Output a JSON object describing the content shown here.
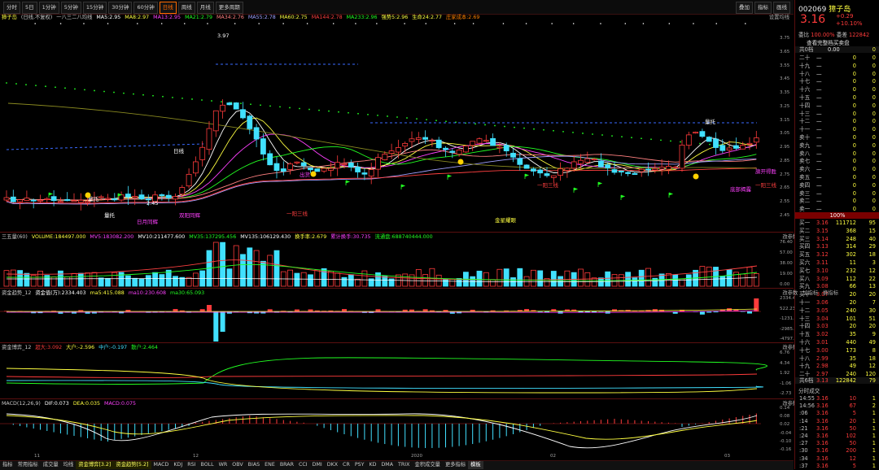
{
  "toolbar": {
    "periods": [
      "分时",
      "5日",
      "1分钟",
      "5分钟",
      "15分钟",
      "30分钟",
      "60分钟",
      "日线",
      "周线",
      "月线",
      "更多周期"
    ],
    "active_period": "日线",
    "right_buttons": [
      "叠加",
      "指标",
      "画线"
    ]
  },
  "main_header": {
    "title": "獐子岛",
    "mode": "(日线,不复权)",
    "items": [
      {
        "text": "一八三二八均线",
        "color": "#c8c8c8"
      },
      {
        "text": "MA5:2.95",
        "color": "#ffffff"
      },
      {
        "text": "MA8:2.97",
        "color": "#ffff40"
      },
      {
        "text": "MA13:2.95",
        "color": "#ff40ff"
      },
      {
        "text": "MA21:2.79",
        "color": "#22ff22"
      },
      {
        "text": "MA34:2.76",
        "color": "#ff8080"
      },
      {
        "text": "MA55:2.78",
        "color": "#a0a0ff"
      },
      {
        "text": "MA60:2.75",
        "color": "#ffff40"
      },
      {
        "text": "MA144:2.78",
        "color": "#ff4040"
      },
      {
        "text": "MA233:2.96",
        "color": "#22ff22"
      },
      {
        "text": "强势5:2.96",
        "color": "#ffff40"
      },
      {
        "text": "生命24:2.77",
        "color": "#ffff40"
      },
      {
        "text": "庄家成本:2.69",
        "color": "#ff8000"
      }
    ],
    "right_label": "设置均线"
  },
  "price_axis": [
    "3.75",
    "3.65",
    "3.55",
    "3.45",
    "3.35",
    "3.25",
    "3.15",
    "3.05",
    "2.95",
    "2.85",
    "2.75",
    "2.65",
    "2.55",
    "2.45"
  ],
  "annotations": [
    {
      "text": "3.97",
      "color": "#ffffff"
    },
    {
      "text": "量托",
      "color": "#ffffff"
    },
    {
      "text": "量托",
      "color": "#ffffff"
    },
    {
      "text": "量托",
      "color": "#ffffff"
    },
    {
      "text": "2.45",
      "color": "#ffffff"
    },
    {
      "text": "日月同辉",
      "color": "#ff40ff"
    },
    {
      "text": "双阳同辉",
      "color": "#ff40ff"
    },
    {
      "text": "日线",
      "color": "#ffffff"
    },
    {
      "text": "一阳三线",
      "color": "#ff4040"
    },
    {
      "text": "一阳三线",
      "color": "#ff4040"
    },
    {
      "text": "一阳三线",
      "color": "#ff4040"
    },
    {
      "text": "金星耀眼",
      "color": "#ffff40"
    },
    {
      "text": "旗开得胜",
      "color": "#ff40ff"
    },
    {
      "text": "底部揭露",
      "color": "#ff40ff"
    },
    {
      "text": "出货",
      "color": "#ff40ff"
    }
  ],
  "volume_panel": {
    "header": [
      {
        "text": "三五量(60)",
        "color": "#c8c8c8"
      },
      {
        "text": "VOLUME:184497.000",
        "color": "#ffff40"
      },
      {
        "text": "MV5:183082.200",
        "color": "#ff40ff"
      },
      {
        "text": "MV10:211477.600",
        "color": "#ffffff"
      },
      {
        "text": "MV35:137295.456",
        "color": "#22ff22"
      },
      {
        "text": "MV135:106129.430",
        "color": "#ffffff"
      },
      {
        "text": "换手率:2.679",
        "color": "#ffff40"
      },
      {
        "text": "累计换手:30.735",
        "color": "#ff40ff"
      },
      {
        "text": "流通盘:688740444.000",
        "color": "#22ff22"
      }
    ],
    "axis": [
      "76.40",
      "57.00",
      "38.00",
      "19.00",
      "0.00"
    ]
  },
  "money_panel": {
    "header": [
      {
        "text": "资金趋势_12",
        "color": "#c8c8c8"
      },
      {
        "text": "资金值(万):2334.403",
        "color": "#ffffff"
      },
      {
        "text": "ma5:415.088",
        "color": "#ffff40"
      },
      {
        "text": "ma10:230.608",
        "color": "#ff40ff"
      },
      {
        "text": "ma30:65.093",
        "color": "#22ff22"
      }
    ],
    "axis": [
      "2334.40",
      "522.23",
      "-1231.48",
      "-2985.21",
      "-4797.38"
    ]
  },
  "flow_panel": {
    "header": [
      {
        "text": "资金博弈_12",
        "color": "#c8c8c8"
      },
      {
        "text": "超大:3.092",
        "color": "#ff3b3b"
      },
      {
        "text": "大户:-2.596",
        "color": "#ffff40"
      },
      {
        "text": "中户:-0.197",
        "color": "#41e0ff"
      },
      {
        "text": "散户:2.464",
        "color": "#22ff22"
      }
    ],
    "axis": [
      "6.76",
      "4.34",
      "1.92",
      "-1.06",
      "-2.73"
    ]
  },
  "macd_panel": {
    "header": [
      {
        "text": "MACD(12,26,9)",
        "color": "#c8c8c8"
      },
      {
        "text": "DIF:0.073",
        "color": "#ffffff"
      },
      {
        "text": "DEA:0.035",
        "color": "#ffff40"
      },
      {
        "text": "MACD:0.075",
        "color": "#ff40ff"
      }
    ],
    "axis": [
      "0.14",
      "0.08",
      "0.02",
      "-0.04",
      "-0.10",
      "-0.16"
    ]
  },
  "panel_tools": [
    "改参数",
    "加指标",
    "换指标"
  ],
  "date_axis": [
    "11",
    "12",
    "2020",
    "02",
    "03"
  ],
  "tabs": [
    "指标",
    "常用指标",
    "成交量",
    "均线",
    "资金博弈[3.2]",
    "资金趋势[5.2]",
    "MACD",
    "KDJ",
    "RSI",
    "BOLL",
    "WR",
    "OBV",
    "BIAS",
    "ENE",
    "BRAR",
    "CCI",
    "DMI",
    "DKX",
    "CR",
    "PSY",
    "KD",
    "DMA",
    "TRIX",
    "金积成交量",
    "更多指标",
    "模板"
  ],
  "highlight_tabs": [
    "资金博弈[3.2]",
    "资金趋势[5.2]"
  ],
  "quote": {
    "code": "002069",
    "name": "獐子岛",
    "price": "3.16",
    "change": "+0.29",
    "change_pct": "+10.10%",
    "weibi_label": "委比",
    "weibi": "100.00%",
    "weicha_label": "委差",
    "weicha": "122842",
    "link": "查看完整档买卖盘",
    "sell_total_label": "共0档",
    "sell_total_price": "0.00",
    "sell_total_vol": "0",
    "sells": [
      {
        "label": "二十",
        "price": "—",
        "vol": "0",
        "n": "0"
      },
      {
        "label": "十九",
        "price": "—",
        "vol": "0",
        "n": "0"
      },
      {
        "label": "十八",
        "price": "—",
        "vol": "0",
        "n": "0"
      },
      {
        "label": "十七",
        "price": "—",
        "vol": "0",
        "n": "0"
      },
      {
        "label": "十六",
        "price": "—",
        "vol": "0",
        "n": "0"
      },
      {
        "label": "十五",
        "price": "—",
        "vol": "0",
        "n": "0"
      },
      {
        "label": "十四",
        "price": "—",
        "vol": "0",
        "n": "0"
      },
      {
        "label": "十三",
        "price": "—",
        "vol": "0",
        "n": "0"
      },
      {
        "label": "十二",
        "price": "—",
        "vol": "0",
        "n": "0"
      },
      {
        "label": "十一",
        "price": "—",
        "vol": "0",
        "n": "0"
      },
      {
        "label": "卖十",
        "price": "—",
        "vol": "0",
        "n": "0"
      },
      {
        "label": "卖九",
        "price": "—",
        "vol": "0",
        "n": "0"
      },
      {
        "label": "卖八",
        "price": "—",
        "vol": "0",
        "n": "0"
      },
      {
        "label": "卖七",
        "price": "—",
        "vol": "0",
        "n": "0"
      },
      {
        "label": "卖六",
        "price": "—",
        "vol": "0",
        "n": "0"
      },
      {
        "label": "卖五",
        "price": "—",
        "vol": "0",
        "n": "0"
      },
      {
        "label": "卖四",
        "price": "—",
        "vol": "0",
        "n": "0"
      },
      {
        "label": "卖三",
        "price": "—",
        "vol": "0",
        "n": "0"
      },
      {
        "label": "卖二",
        "price": "—",
        "vol": "0",
        "n": "0"
      },
      {
        "label": "卖一",
        "price": "—",
        "vol": "0",
        "n": "0"
      }
    ],
    "bar_pct": "100%",
    "buys": [
      {
        "label": "买一",
        "price": "3.16",
        "vol": "111712",
        "n": "95"
      },
      {
        "label": "买二",
        "price": "3.15",
        "vol": "368",
        "n": "15"
      },
      {
        "label": "买三",
        "price": "3.14",
        "vol": "248",
        "n": "40"
      },
      {
        "label": "买四",
        "price": "3.13",
        "vol": "314",
        "n": "29"
      },
      {
        "label": "买五",
        "price": "3.12",
        "vol": "302",
        "n": "18"
      },
      {
        "label": "买六",
        "price": "3.11",
        "vol": "11",
        "n": "3"
      },
      {
        "label": "买七",
        "price": "3.10",
        "vol": "232",
        "n": "12"
      },
      {
        "label": "买八",
        "price": "3.09",
        "vol": "112",
        "n": "22"
      },
      {
        "label": "买九",
        "price": "3.08",
        "vol": "66",
        "n": "13"
      },
      {
        "label": "买十",
        "price": "3.07",
        "vol": "20",
        "n": "20"
      },
      {
        "label": "十一",
        "price": "3.06",
        "vol": "20",
        "n": "7"
      },
      {
        "label": "十二",
        "price": "3.05",
        "vol": "240",
        "n": "30"
      },
      {
        "label": "十三",
        "price": "3.04",
        "vol": "101",
        "n": "51"
      },
      {
        "label": "十四",
        "price": "3.03",
        "vol": "20",
        "n": "20"
      },
      {
        "label": "十五",
        "price": "3.02",
        "vol": "35",
        "n": "9"
      },
      {
        "label": "十六",
        "price": "3.01",
        "vol": "440",
        "n": "49"
      },
      {
        "label": "十七",
        "price": "3.00",
        "vol": "173",
        "n": "8"
      },
      {
        "label": "十八",
        "price": "2.99",
        "vol": "35",
        "n": "18"
      },
      {
        "label": "十九",
        "price": "2.98",
        "vol": "49",
        "n": "12"
      },
      {
        "label": "二十",
        "price": "2.97",
        "vol": "240",
        "n": "120"
      }
    ],
    "buy_total_label": "共6档",
    "buy_total_price": "3.13",
    "buy_total_vol": "122842",
    "buy_total_n": "79",
    "trades_title": "分时成交",
    "trades": [
      {
        "t": "14:55",
        "p": "3.16",
        "v": "10",
        "n": "1"
      },
      {
        "t": "14:56",
        "p": "3.16",
        "v": "67",
        "n": "2"
      },
      {
        "t": ":06",
        "p": "3.16",
        "v": "5",
        "n": "1"
      },
      {
        "t": ":14",
        "p": "3.16",
        "v": "20",
        "n": "1"
      },
      {
        "t": ":21",
        "p": "3.16",
        "v": "50",
        "n": "1"
      },
      {
        "t": ":24",
        "p": "3.16",
        "v": "102",
        "n": "1"
      },
      {
        "t": ":27",
        "p": "3.16",
        "v": "50",
        "n": "1"
      },
      {
        "t": ":30",
        "p": "3.16",
        "v": "200",
        "n": "1"
      },
      {
        "t": ":34",
        "p": "3.16",
        "v": "12",
        "n": "1"
      },
      {
        "t": ":37",
        "p": "3.16",
        "v": "5",
        "n": "1"
      }
    ]
  },
  "colors": {
    "up": "#ff3b3b",
    "down": "#41e0ff",
    "bg": "#000000",
    "grid": "#5a0f0f"
  }
}
